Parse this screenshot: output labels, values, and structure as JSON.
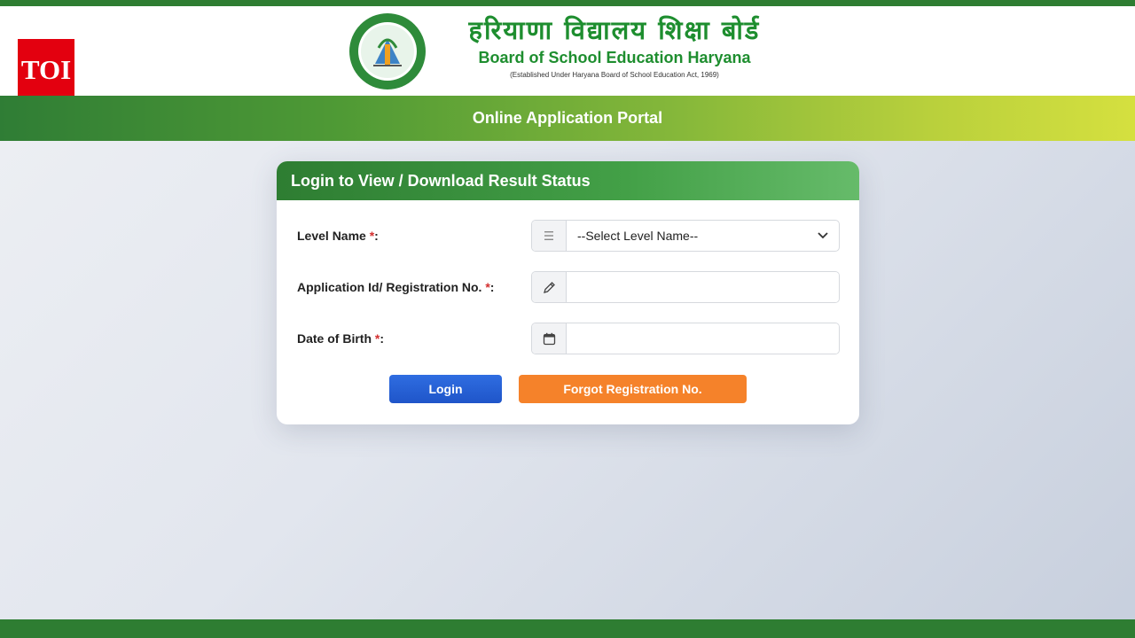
{
  "header": {
    "toi_logo": "TOI",
    "board_name_hindi": "हरियाणा विद्यालय शिक्षा बोर्ड",
    "board_name_english": "Board of School Education Haryana",
    "established_text": "(Established Under Haryana Board of School Education Act, 1969)",
    "emblem_icon": "hbse-emblem-icon"
  },
  "portal": {
    "title": "Online Application Portal"
  },
  "login_card": {
    "title": "Login to View / Download Result Status",
    "required_marker": "*",
    "level": {
      "label": "Level Name ",
      "suffix": ":",
      "selected": "--Select Level Name--",
      "icon": "list-icon"
    },
    "application": {
      "label": "Application Id/ Registration No. ",
      "suffix": ":",
      "value": "",
      "icon": "pencil-icon"
    },
    "dob": {
      "label": "Date of Birth ",
      "suffix": ":",
      "value": "",
      "icon": "calendar-icon"
    },
    "login_button": "Login",
    "forgot_button": "Forgot Registration No."
  },
  "colors": {
    "brand_green": "#2e7d32",
    "login_blue": "#2f6de1",
    "forgot_orange": "#f5822a",
    "toi_red": "#e3000f"
  }
}
